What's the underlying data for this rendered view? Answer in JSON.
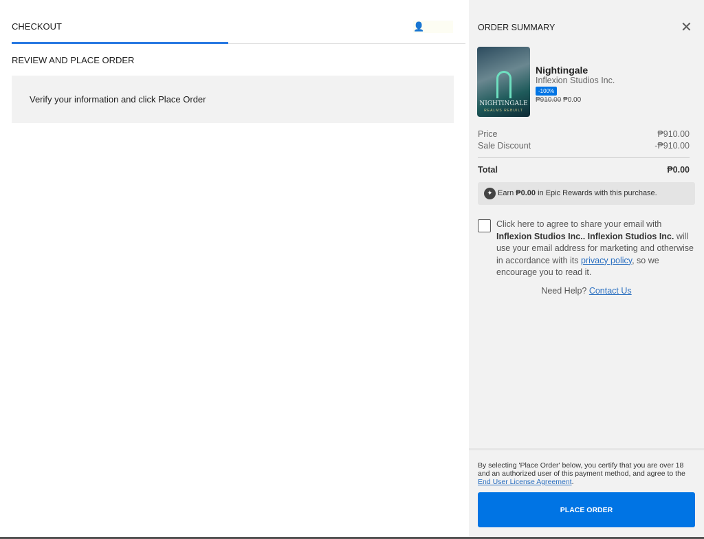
{
  "checkout": {
    "title": "CHECKOUT",
    "user_icon": "user-icon",
    "step": "REVIEW AND PLACE ORDER",
    "message": "Verify your information and click Place Order",
    "progress_percent": 50
  },
  "summary": {
    "title": "ORDER SUMMARY",
    "close_icon": "close-icon",
    "item": {
      "cover_text": "NIGHTINGALE",
      "cover_subtitle": "REALMS REBUILT",
      "name": "Nightingale",
      "publisher": "Inflexion Studios Inc.",
      "discount_badge": "-100%",
      "original_price": "₱910.00",
      "sale_price": "₱0.00"
    },
    "price_label": "Price",
    "price_value": "₱910.00",
    "discount_label": "Sale Discount",
    "discount_value": "-₱910.00",
    "total_label": "Total",
    "total_value": "₱0.00",
    "rewards": {
      "pre": "Earn ",
      "amount": "₱0.00",
      "post": " in Epic Rewards with this purchase."
    },
    "agree": {
      "t1": "Click here to agree to share your email with ",
      "b1": "Inflexion Studios Inc.. Inflexion Studios Inc.",
      "t2": " will use your email address for marketing and otherwise in accordance with its ",
      "link": "privacy policy",
      "t3": ", so we encourage you to read it."
    },
    "help": {
      "label": "Need Help? ",
      "link": "Contact Us"
    },
    "legal": {
      "text": "By selecting 'Place Order' below, you certify that you are over 18 and an authorized user of this payment method, and agree to the ",
      "link": "End User License Agreement",
      "end": "."
    },
    "place_order": "PLACE ORDER"
  }
}
